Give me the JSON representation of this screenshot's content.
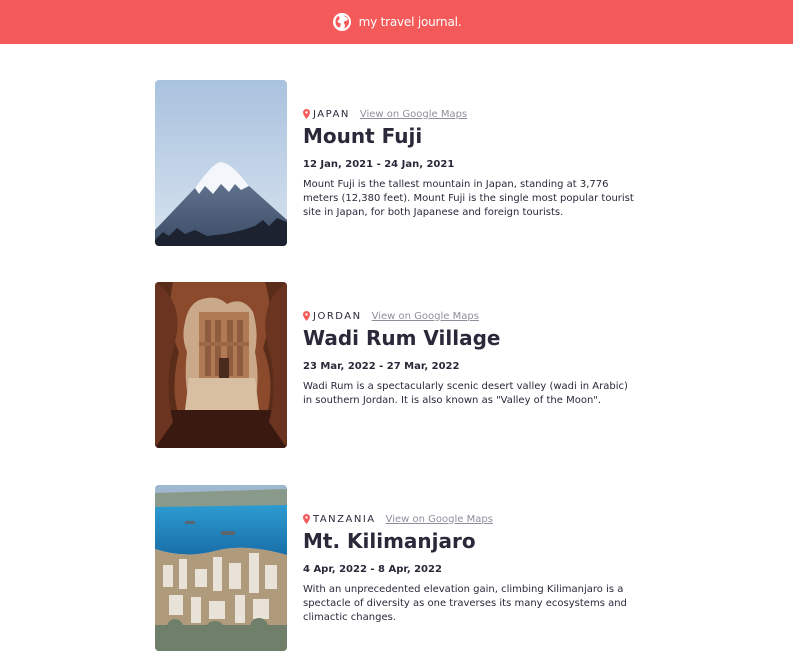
{
  "header": {
    "brand": "my travel journal.",
    "icon": "globe-icon"
  },
  "entries": [
    {
      "country": "JAPAN",
      "maps_link": "View on Google Maps",
      "title": "Mount Fuji",
      "dates": "12 Jan, 2021 - 24 Jan, 2021",
      "description": "Mount Fuji is the tallest mountain in Japan, standing at 3,776 meters (12,380 feet). Mount Fuji is the single most popular tourist site in Japan, for both Japanese and foreign tourists."
    },
    {
      "country": "JORDAN",
      "maps_link": "View on Google Maps",
      "title": "Wadi Rum Village",
      "dates": "23 Mar, 2022 - 27 Mar, 2022",
      "description": "Wadi Rum is a spectacularly scenic desert valley (wadi in Arabic) in southern Jordan. It is also known as \"Valley of the Moon\"."
    },
    {
      "country": "TANZANIA",
      "maps_link": "View on Google Maps",
      "title": "Mt. Kilimanjaro",
      "dates": "4 Apr, 2022 - 8 Apr, 2022",
      "description": "With an unprecedented elevation gain, climbing Kilimanjaro is a spectacle of diversity as one traverses its many ecosystems and climactic changes."
    }
  ],
  "colors": {
    "accent": "#f55a5a",
    "text": "#2b283a",
    "muted": "#918e9b"
  }
}
